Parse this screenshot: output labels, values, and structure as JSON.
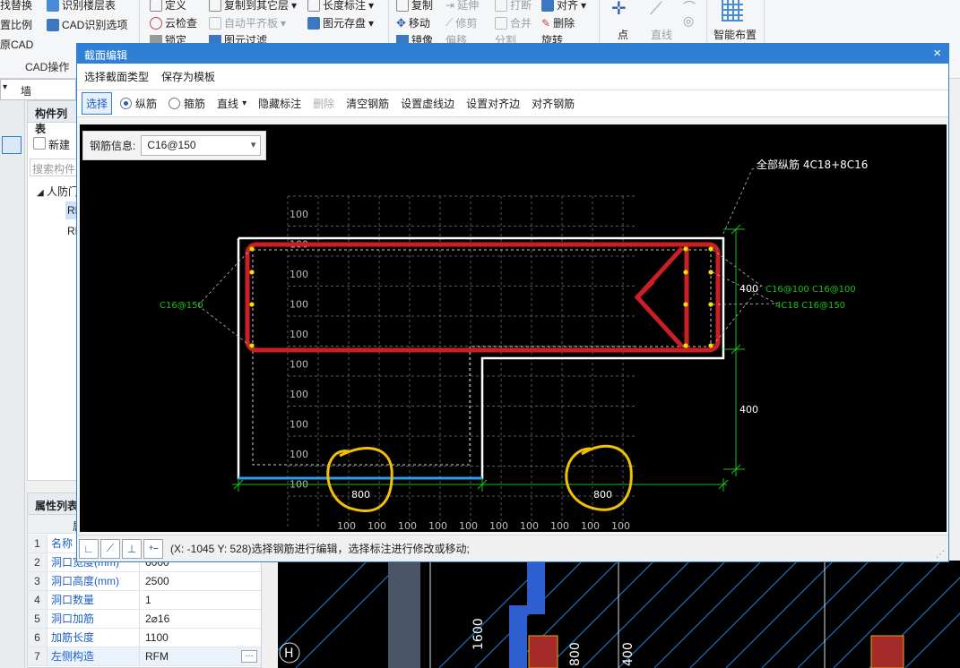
{
  "ribbon": {
    "left_items": [
      "找替换",
      "置比例",
      "原CAD"
    ],
    "cad_items": [
      "识别楼层表",
      "CAD识别选项"
    ],
    "group_label": "CAD操作",
    "col2": [
      "定义",
      "云检查",
      "锁定"
    ],
    "col3": [
      "复制到其它层",
      "自动平齐板",
      "图元过滤"
    ],
    "col4": [
      "长度标注",
      "图元存盘"
    ],
    "col5": [
      "复制",
      "移动",
      "镜像"
    ],
    "col6": [
      "延伸",
      "修剪",
      "偏移"
    ],
    "col7": [
      "打断",
      "合并",
      "分割"
    ],
    "col8": [
      "对齐",
      "删除",
      "旋转"
    ],
    "draw_point": "点",
    "draw_line": "直线",
    "smart_layout": "智能布置"
  },
  "combo": {
    "value": "墙"
  },
  "component_panel": {
    "title": "构件列表",
    "new_label": "新建",
    "search_placeholder": "搜索构件...",
    "tree_root": "人防门",
    "tree_item_1": "RF",
    "tree_item_2": "RF"
  },
  "property_panel": {
    "title": "属性列表",
    "header_col": "属",
    "rows": [
      {
        "idx": "1",
        "name": "名称",
        "value": ""
      },
      {
        "idx": "2",
        "name": "洞口宽度(mm)",
        "value": "6000"
      },
      {
        "idx": "3",
        "name": "洞口高度(mm)",
        "value": "2500"
      },
      {
        "idx": "4",
        "name": "洞口数量",
        "value": "1"
      },
      {
        "idx": "5",
        "name": "洞口加筋",
        "value": "2⌀16"
      },
      {
        "idx": "6",
        "name": "加筋长度",
        "value": "1100"
      },
      {
        "idx": "7",
        "name": "左侧构造",
        "value": "RFM"
      }
    ]
  },
  "dialog": {
    "title": "截面编辑",
    "close": "×",
    "menu": [
      "选择截面类型",
      "保存为模板"
    ],
    "toolbar": {
      "select": "选择",
      "longitudinal": "纵筋",
      "stirrup": "箍筋",
      "line": "直线",
      "hide_annotation": "隐藏标注",
      "delete": "删除",
      "clear_rebar": "清空钢筋",
      "set_dashed_edge": "设置虚线边",
      "set_align_edge": "设置对齐边",
      "align_rebar": "对齐钢筋"
    },
    "rebar_info_label": "钢筋信息:",
    "rebar_info_value": "C16@150",
    "status": "(X: -1045 Y: 528)选择钢筋进行编辑，选择标注进行修改或移动;"
  },
  "drawing": {
    "all_longitudinal": "全部纵筋  4C18+8C16",
    "left_label": "C16@150",
    "right_top_label": "C16@100  C16@100",
    "right_mid_label": "4C18  C16@150",
    "dim_400_a": "400",
    "dim_400_b": "400",
    "dim_800_a": "800",
    "dim_800_b": "800",
    "grid_label": "100"
  },
  "cad": {
    "axis": "H",
    "dim_1600": "1600",
    "dim_800": "800",
    "dim_400": "400"
  },
  "colors": {
    "accent": "#2f7fd6",
    "rebar": "#cc1f24",
    "dim": "#19c019",
    "annot": "#f2c200"
  }
}
